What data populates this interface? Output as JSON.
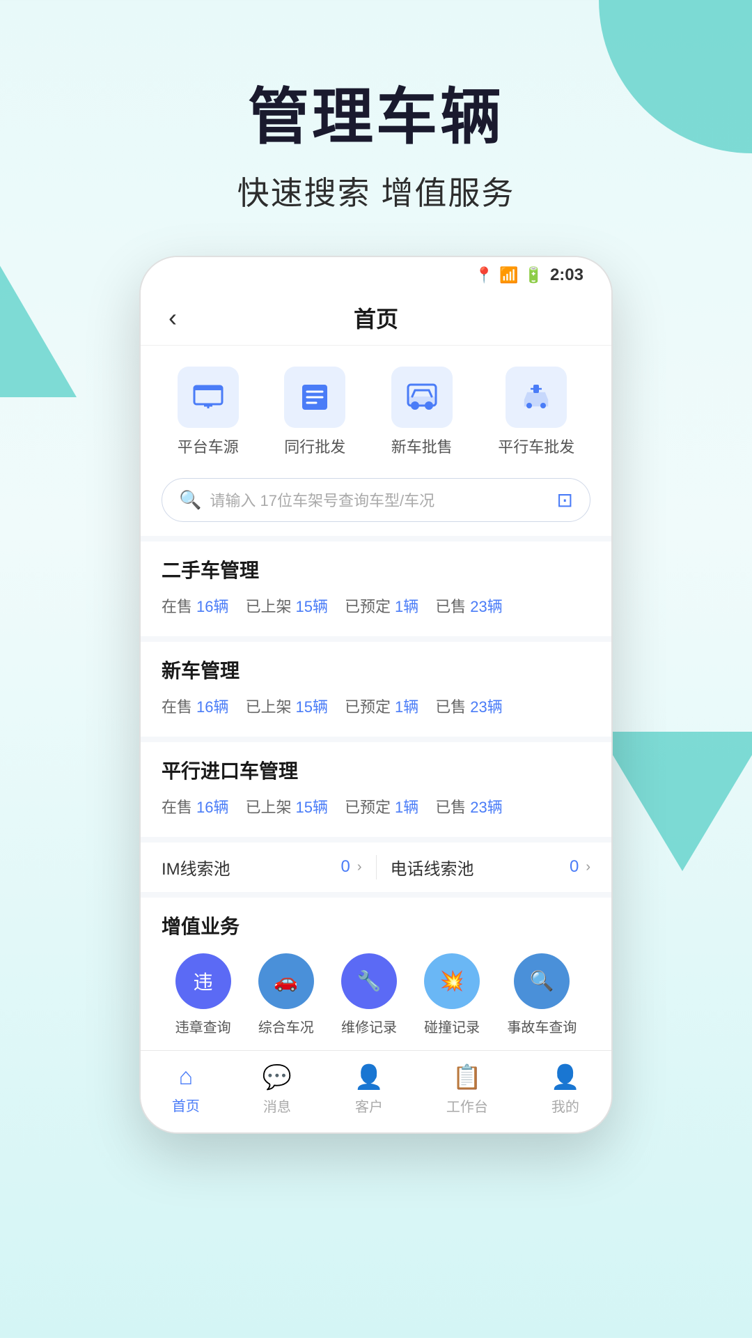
{
  "hero": {
    "title": "管理车辆",
    "subtitle": "快速搜索 增值服务"
  },
  "phone": {
    "statusBar": {
      "time": "2:03",
      "icons": "📍 📶 🔋"
    },
    "navBar": {
      "title": "首页",
      "backLabel": "‹"
    },
    "quickMenu": {
      "items": [
        {
          "label": "平台车源",
          "iconType": "screen"
        },
        {
          "label": "同行批发",
          "iconType": "list"
        },
        {
          "label": "新车批售",
          "iconType": "car-front"
        },
        {
          "label": "平行车批发",
          "iconType": "car-gift"
        }
      ]
    },
    "searchBar": {
      "placeholder": "请输入 17位车架号查询车型/车况"
    },
    "sections": [
      {
        "title": "二手车管理",
        "stats": [
          {
            "label": "在售",
            "value": "16辆"
          },
          {
            "label": "已上架",
            "value": "15辆"
          },
          {
            "label": "已预定",
            "value": "1辆"
          },
          {
            "label": "已售",
            "value": "23辆"
          }
        ]
      },
      {
        "title": "新车管理",
        "stats": [
          {
            "label": "在售",
            "value": "16辆"
          },
          {
            "label": "已上架",
            "value": "15辆"
          },
          {
            "label": "已预定",
            "value": "1辆"
          },
          {
            "label": "已售",
            "value": "23辆"
          }
        ]
      },
      {
        "title": "平行进口车管理",
        "stats": [
          {
            "label": "在售",
            "value": "16辆"
          },
          {
            "label": "已上架",
            "value": "15辆"
          },
          {
            "label": "已预定",
            "value": "1辆"
          },
          {
            "label": "已售",
            "value": "23辆"
          }
        ]
      }
    ],
    "leadPool": {
      "im": {
        "name": "IM线索池",
        "count": "0"
      },
      "phone": {
        "name": "电话线索池",
        "count": "0"
      }
    },
    "valueAdded": {
      "title": "增值业务",
      "items": [
        {
          "label": "违章查询",
          "iconClass": "icon-violation",
          "symbol": "违"
        },
        {
          "label": "综合车况",
          "iconClass": "icon-car",
          "symbol": "🚗"
        },
        {
          "label": "维修记录",
          "iconClass": "icon-maintenance",
          "symbol": "🔧"
        },
        {
          "label": "碰撞记录",
          "iconClass": "icon-collision",
          "symbol": "💥"
        },
        {
          "label": "事故车查询",
          "iconClass": "icon-search",
          "symbol": "🔍"
        }
      ]
    },
    "bottomNav": {
      "items": [
        {
          "label": "首页",
          "active": true,
          "icon": "⌂"
        },
        {
          "label": "消息",
          "active": false,
          "icon": "💬"
        },
        {
          "label": "客户",
          "active": false,
          "icon": "👤"
        },
        {
          "label": "工作台",
          "active": false,
          "icon": "📋"
        },
        {
          "label": "我的",
          "active": false,
          "icon": "👤"
        }
      ]
    }
  }
}
